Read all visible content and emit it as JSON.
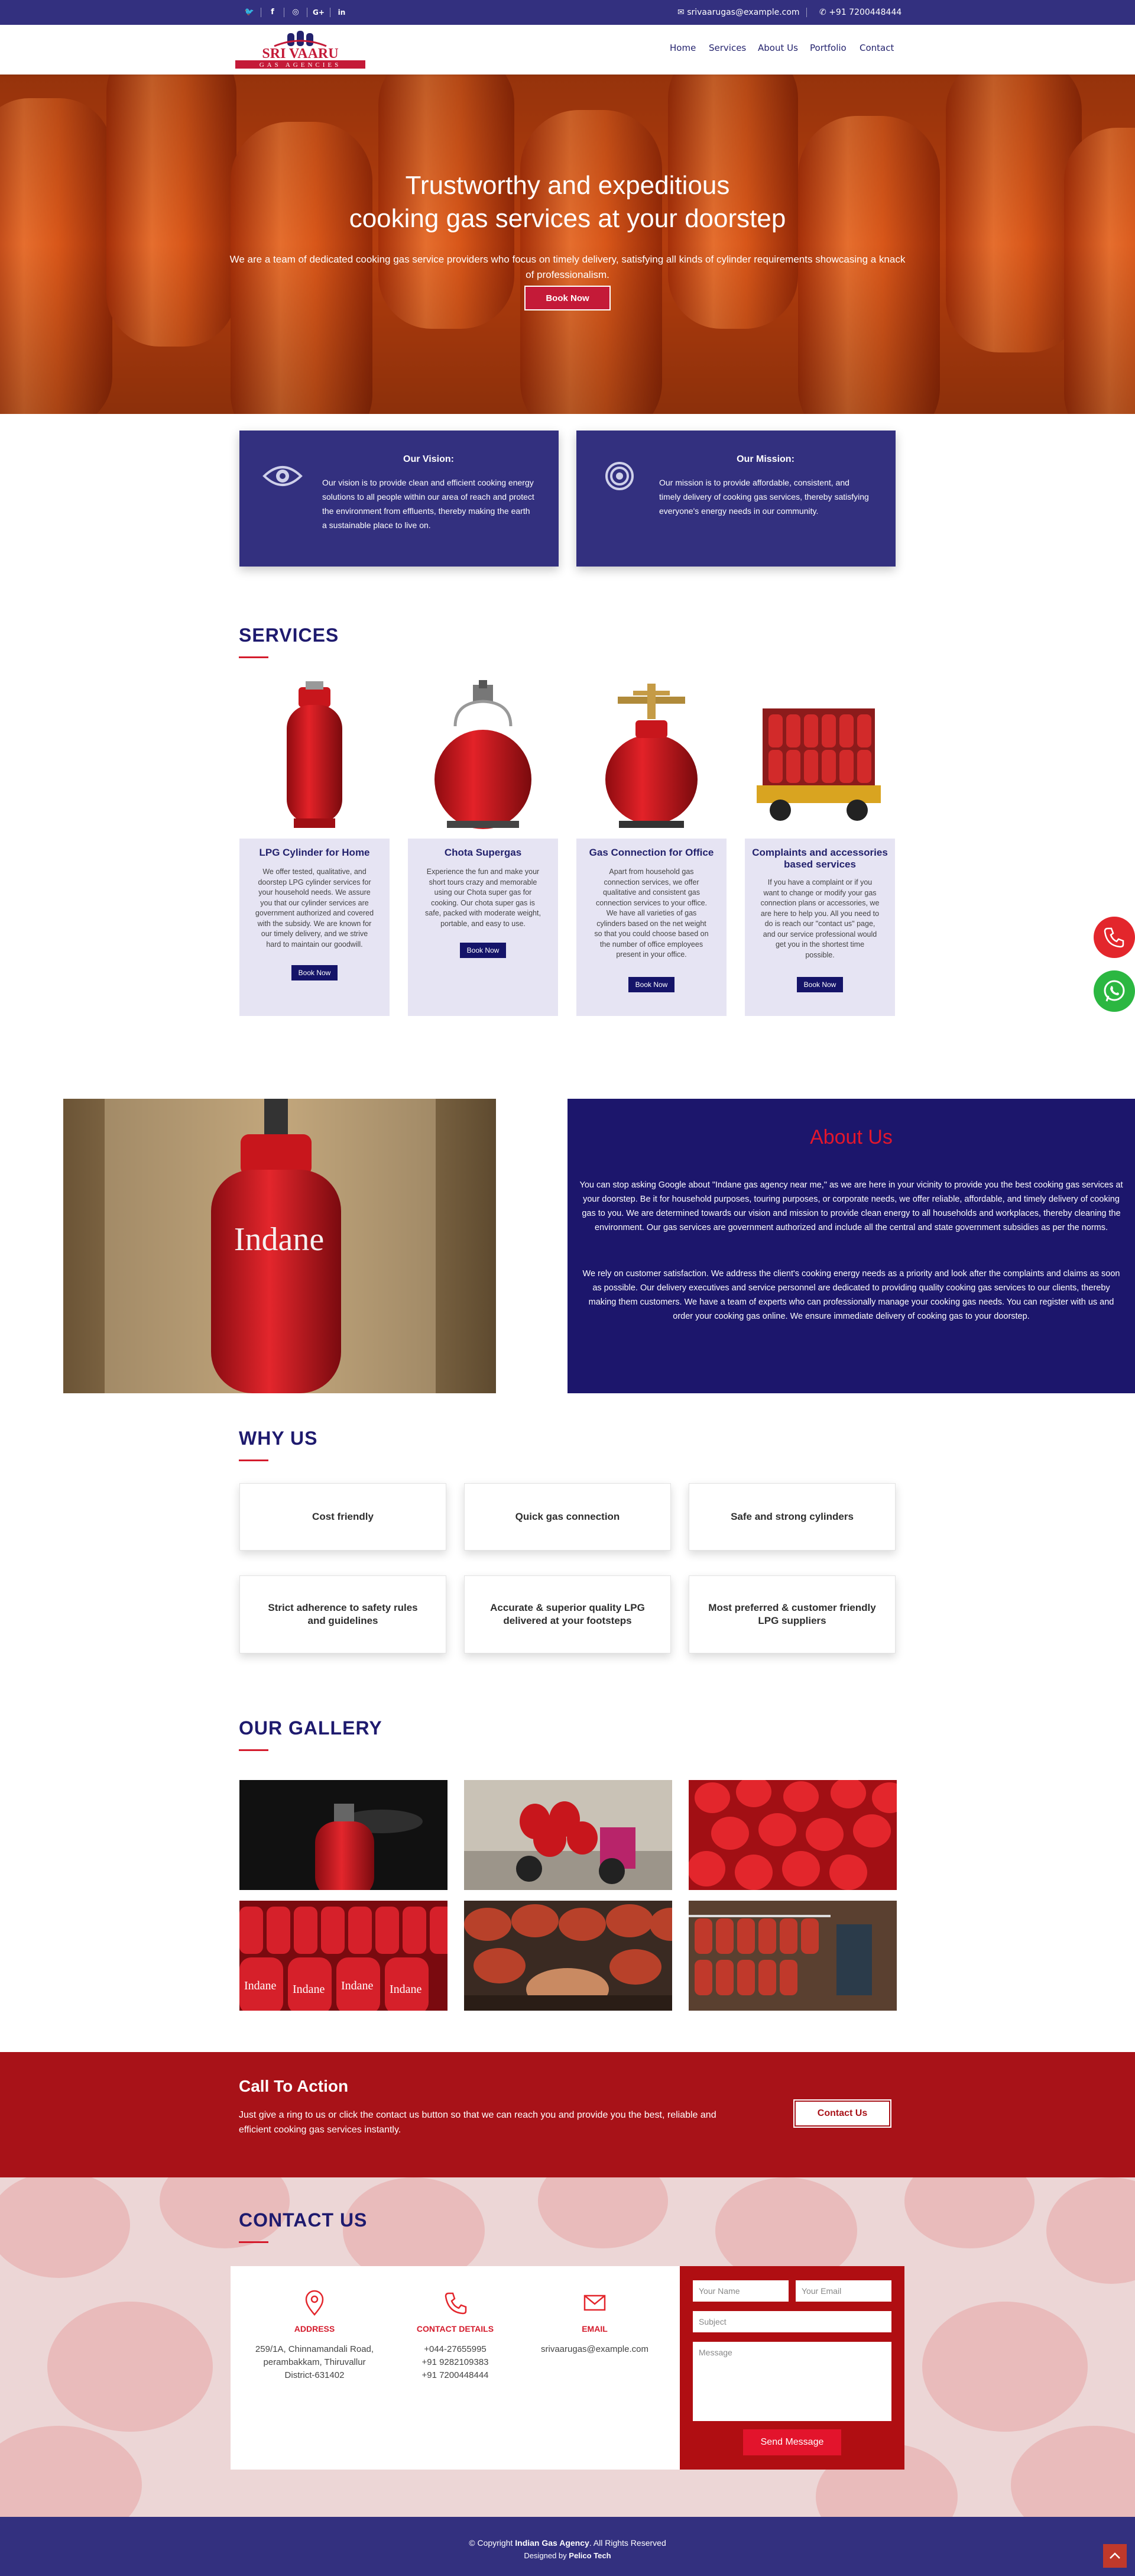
{
  "topbar": {
    "social": [
      {
        "icon": "twitter-icon",
        "glyph": "🐦"
      },
      {
        "icon": "facebook-icon",
        "glyph": "f"
      },
      {
        "icon": "instagram-icon",
        "glyph": "◎"
      },
      {
        "icon": "google-plus-icon",
        "glyph": "G+"
      },
      {
        "icon": "linkedin-icon",
        "glyph": "in"
      }
    ],
    "email": "srivaarugas@example.com",
    "phone": "+91 7200448444"
  },
  "header": {
    "logo_text": "SRI VAARU",
    "logo_sub": "GAS AGENCIES",
    "nav": [
      "Home",
      "Services",
      "About Us",
      "Portfolio",
      "Contact"
    ]
  },
  "hero": {
    "title_line1": "Trustworthy and expeditious",
    "title_line2": "cooking gas services at your doorstep",
    "subtitle": "We are a team of dedicated cooking gas service providers who focus on timely delivery, satisfying all kinds of cylinder requirements showcasing a knack of professionalism.",
    "button": "Book Now"
  },
  "vision": {
    "title": "Our Vision:",
    "text": "Our vision is to provide clean and efficient cooking energy solutions to all people within our area of reach and protect the environment from effluents, thereby making the earth a sustainable place to live on."
  },
  "mission": {
    "title": "Our Mission:",
    "text": "Our mission is to provide affordable, consistent, and timely delivery of cooking gas services, thereby satisfying everyone's energy needs in our community."
  },
  "services": {
    "title": "SERVICES",
    "items": [
      {
        "title": "LPG Cylinder for Home",
        "text": "We offer tested, qualitative, and doorstep LPG cylinder services for your household needs. We assure you that our cylinder services are government authorized and covered with the subsidy. We are known for our timely delivery, and we strive hard to maintain our goodwill.",
        "button": "Book Now"
      },
      {
        "title": "Chota Supergas",
        "text": "Experience the fun and make your short tours crazy and memorable using our Chota super gas for cooking. Our chota super gas is safe, packed with moderate weight, portable, and easy to use.",
        "button": "Book Now"
      },
      {
        "title": "Gas Connection for Office",
        "text": "Apart from household gas connection services, we offer qualitative and consistent gas connection services to your office. We have all varieties of gas cylinders based on the net weight so that you could choose based on the number of office employees present in your office.",
        "button": "Book Now"
      },
      {
        "title": "Complaints and accessories based services",
        "text": "If you have a complaint or if you want to change or modify your gas connection plans or accessories, we are here to help you. All you need to do is reach our \"contact us\" page, and our service professional would get you in the shortest time possible.",
        "button": "Book Now"
      }
    ]
  },
  "about": {
    "title": "About Us",
    "image_label": "Indane",
    "p1": "You can stop asking Google about \"Indane gas agency near me,\" as we are here in your vicinity to provide you the best cooking gas services at your doorstep. Be it for household purposes, touring purposes, or corporate needs, we offer reliable, affordable, and timely delivery of cooking gas to you. We are determined towards our vision and mission to provide clean energy to all households and workplaces, thereby cleaning the environment. Our gas services are government authorized and include all the central and state government subsidies as per the norms.",
    "p2": "We rely on customer satisfaction. We address the client's cooking energy needs as a priority and look after the complaints and claims as soon as possible. Our delivery executives and service personnel are dedicated to providing quality cooking gas services to our clients, thereby making them customers. We have a team of experts who can professionally manage your cooking gas needs. You can register with us and order your cooking gas online. We ensure immediate delivery of cooking gas to your doorstep."
  },
  "why_us": {
    "title": "WHY US",
    "items": [
      "Cost friendly",
      "Quick gas connection",
      "Safe and strong cylinders",
      "Strict adherence to safety rules and guidelines",
      "Accurate & superior quality LPG delivered at your footsteps",
      "Most preferred & customer friendly LPG suppliers"
    ]
  },
  "gallery": {
    "title": "OUR GALLERY",
    "cylinder_label": "Indane"
  },
  "cta": {
    "title": "Call To Action",
    "text": "Just give a ring to us or click the contact us button so that we can reach you and provide you the best, reliable and efficient cooking gas services instantly.",
    "button": "Contact Us"
  },
  "contact": {
    "title": "CONTACT US",
    "address_label": "ADDRESS",
    "address_lines": [
      "259/1A, Chinnamandali Road,",
      "perambakkam, Thiruvallur",
      "District-631402"
    ],
    "details_label": "CONTACT DETAILS",
    "phones": [
      "+044-27655995",
      "+91 9282109383",
      "+91 7200448444"
    ],
    "email_label": "EMAIL",
    "email": "srivaarugas@example.com",
    "form": {
      "name_placeholder": "Your Name",
      "email_placeholder": "Your Email",
      "subject_placeholder": "Subject",
      "message_placeholder": "Message",
      "send": "Send Message"
    }
  },
  "footer": {
    "copy_prefix": "© Copyright",
    "company": "Indian Gas Agency",
    "copy_suffix": ". All Rights Reserved",
    "designed_prefix": "Designed by",
    "designer": "Pelico Tech"
  },
  "colors": {
    "primary": "#33307f",
    "navy": "#1c166c",
    "accent_red": "#d41b2c",
    "cta_red": "#a81218"
  }
}
